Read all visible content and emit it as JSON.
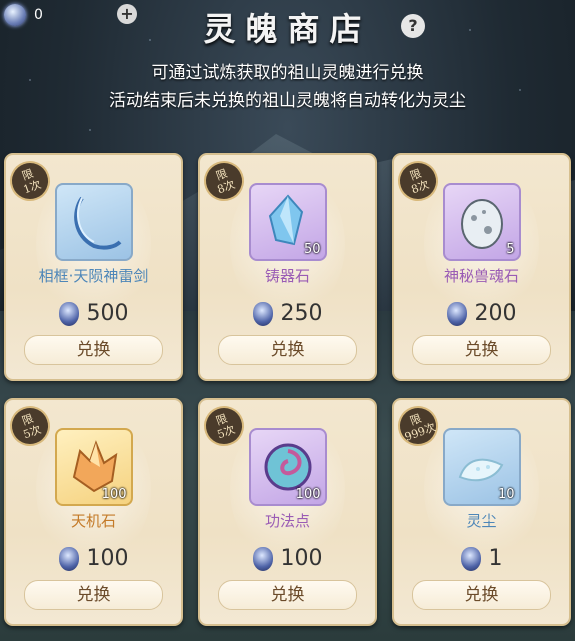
{
  "header": {
    "currency_count": "0",
    "plus_label": "+",
    "title": "灵魄商店",
    "help_label": "?",
    "desc_line1": "可通过试炼获取的祖山灵魄进行兑换",
    "desc_line2": "活动结束后未兑换的祖山灵魄将自动转化为灵尘"
  },
  "shop": {
    "items": [
      {
        "limit_top": "限",
        "limit_bottom": "1次",
        "name": "相框·天陨神雷剑",
        "qty": "",
        "price": "500",
        "button": "兑换",
        "icon": "frame-ring-icon",
        "rarity": "blue"
      },
      {
        "limit_top": "限",
        "limit_bottom": "8次",
        "name": "铸器石",
        "qty": "50",
        "price": "250",
        "button": "兑换",
        "icon": "crystal-icon",
        "rarity": "purple"
      },
      {
        "limit_top": "限",
        "limit_bottom": "8次",
        "name": "神秘兽魂石",
        "qty": "5",
        "price": "200",
        "button": "兑换",
        "icon": "egg-stone-icon",
        "rarity": "purple"
      },
      {
        "limit_top": "限",
        "limit_bottom": "5次",
        "name": "天机石",
        "qty": "100",
        "price": "100",
        "button": "兑换",
        "icon": "gold-crystal-icon",
        "rarity": "gold"
      },
      {
        "limit_top": "限",
        "limit_bottom": "5次",
        "name": "功法点",
        "qty": "100",
        "price": "100",
        "button": "兑换",
        "icon": "swirl-orb-icon",
        "rarity": "purple"
      },
      {
        "limit_top": "限",
        "limit_bottom": "999次",
        "name": "灵尘",
        "qty": "10",
        "price": "1",
        "button": "兑换",
        "icon": "dust-icon",
        "rarity": "blue"
      }
    ]
  },
  "colors": {
    "blue_name": "#4d86b8",
    "purple_name": "#9a5cb5",
    "gold_name": "#c47a28"
  }
}
